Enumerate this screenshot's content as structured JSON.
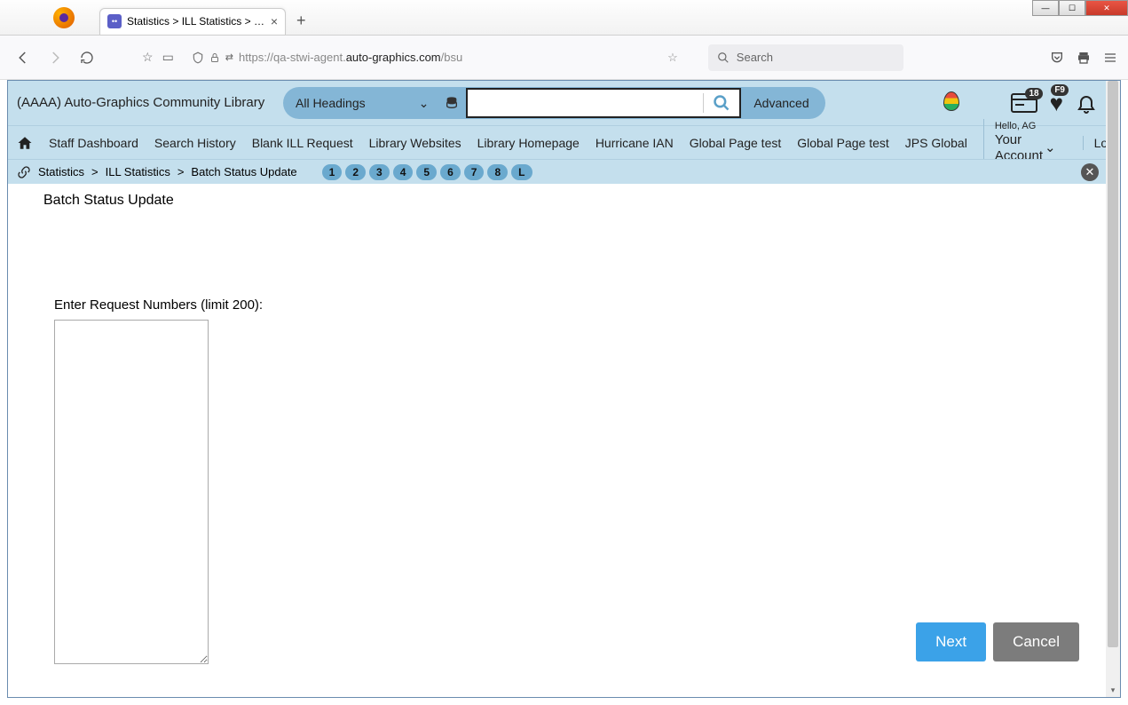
{
  "browser": {
    "tab_title": "Statistics > ILL Statistics > Batch…",
    "url_prefix": "https://qa-stwi-agent.",
    "url_domain": "auto-graphics.com",
    "url_path": "/bsu",
    "search_placeholder": "Search"
  },
  "header": {
    "library_name": "(AAAA) Auto-Graphics Community Library",
    "dropdown_label": "All Headings",
    "advanced_label": "Advanced",
    "card_badge": "18",
    "heart_badge": "F9"
  },
  "nav": {
    "items": [
      "Staff Dashboard",
      "Search History",
      "Blank ILL Request",
      "Library Websites",
      "Library Homepage",
      "Hurricane IAN",
      "Global Page test",
      "Global Page test",
      "JPS Global"
    ],
    "hello": "Hello, AG",
    "account": "Your Account",
    "logout": "Logout"
  },
  "breadcrumb": {
    "items": [
      "Statistics",
      "ILL Statistics",
      "Batch Status Update"
    ],
    "pills": [
      "1",
      "2",
      "3",
      "4",
      "5",
      "6",
      "7",
      "8",
      "L"
    ]
  },
  "page": {
    "title": "Batch Status Update",
    "input_label": "Enter Request Numbers (limit 200):",
    "next_label": "Next",
    "cancel_label": "Cancel"
  }
}
